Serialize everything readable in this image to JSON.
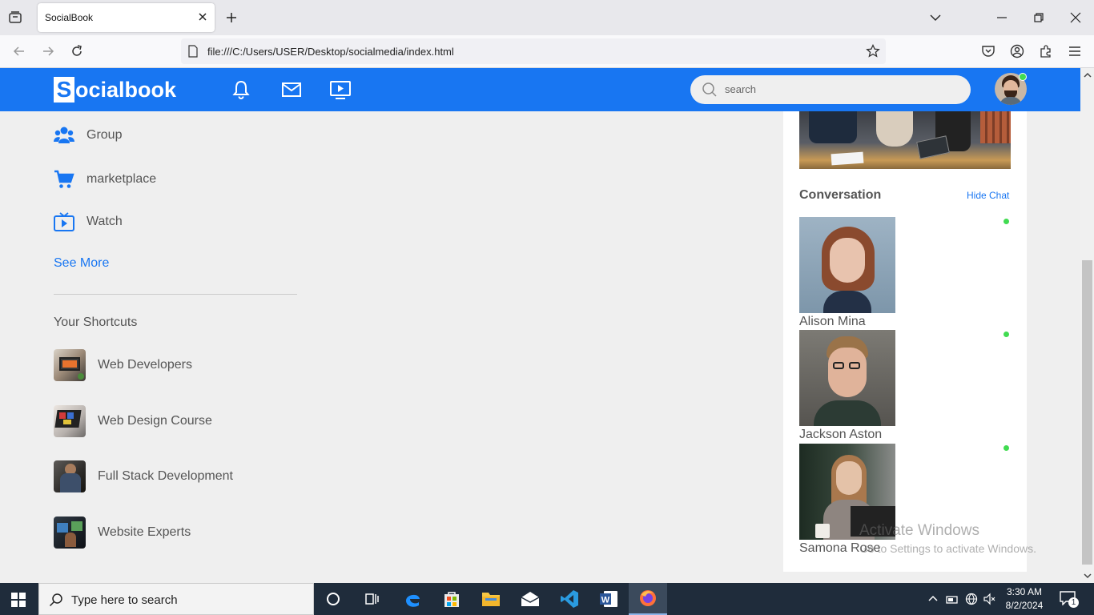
{
  "browser": {
    "tab_title": "SocialBook",
    "url": "file:///C:/Users/USER/Desktop/socialmedia/index.html"
  },
  "site": {
    "logo_letter": "S",
    "logo_text": "ocialbook",
    "search_placeholder": "search",
    "brand_color": "#1876f2"
  },
  "sidebar": {
    "links": [
      {
        "label": "Group",
        "icon": "group-icon"
      },
      {
        "label": "marketplace",
        "icon": "cart-icon"
      },
      {
        "label": "Watch",
        "icon": "tv-icon"
      }
    ],
    "see_more": "See More",
    "shortcuts_title": "Your Shortcuts",
    "shortcuts": [
      {
        "label": "Web Developers"
      },
      {
        "label": "Web Design Course"
      },
      {
        "label": "Full Stack Development"
      },
      {
        "label": "Website Experts"
      }
    ]
  },
  "right": {
    "conversation_title": "Conversation",
    "hide_chat": "Hide Chat",
    "contacts": [
      {
        "name": "Alison Mina",
        "online": true
      },
      {
        "name": "Jackson Aston",
        "online": true
      },
      {
        "name": "Samona Rose",
        "online": true
      }
    ]
  },
  "watermark": {
    "line1": "Activate Windows",
    "line2": "Go to Settings to activate Windows."
  },
  "taskbar": {
    "search_placeholder": "Type here to search",
    "time": "3:30 AM",
    "date": "8/2/2024",
    "notification_count": "1"
  }
}
